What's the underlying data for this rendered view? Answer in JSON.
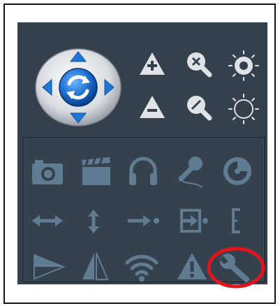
{
  "ptz": {
    "direction_pad": {
      "icons": [
        "arrow-up-icon",
        "arrow-down-icon",
        "arrow-left-icon",
        "arrow-right-icon",
        "refresh-icon"
      ]
    },
    "zoom": {
      "icons": [
        "zoom-in-icon",
        "zoom-out-icon"
      ]
    },
    "focus": {
      "icons": [
        "focus-near-icon",
        "focus-far-icon"
      ]
    },
    "iris": {
      "icons": [
        "iris-open-icon",
        "iris-close-icon"
      ]
    }
  },
  "toolbar": {
    "rows": [
      [
        "camera-icon",
        "clapperboard-icon",
        "headphones-icon",
        "microphone-icon",
        "record-timer-icon"
      ],
      [
        "arrows-horizontal-icon",
        "arrows-vertical-icon",
        "arrow-right-dot-icon",
        "enter-box-icon",
        "bracket-e-icon"
      ],
      [
        "triangle-right-icon",
        "triangle-split-icon",
        "wifi-icon",
        "warning-icon",
        "wrench-icon"
      ]
    ]
  },
  "colors": {
    "panel": "#34414d",
    "icon": "#5f7c92",
    "accent_blue": "#1e6fc8",
    "highlight": "#e0151d"
  }
}
